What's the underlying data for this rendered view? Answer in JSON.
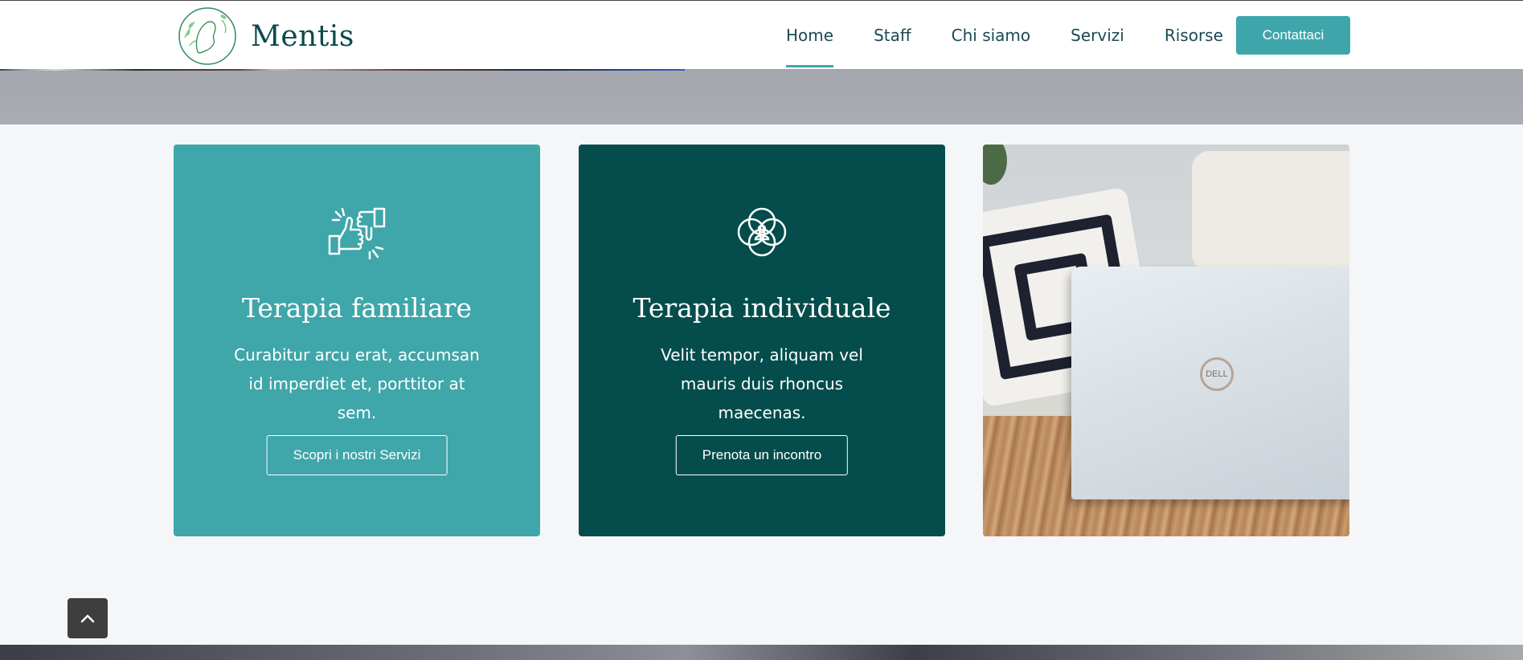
{
  "brand": {
    "name": "Mentis",
    "accent": "#3ea6aa",
    "dark": "#044d4c"
  },
  "nav": {
    "items": [
      {
        "label": "Home",
        "active": true
      },
      {
        "label": "Staff"
      },
      {
        "label": "Chi siamo"
      },
      {
        "label": "Servizi"
      },
      {
        "label": "Risorse"
      }
    ],
    "cta": "Contattaci"
  },
  "cards": [
    {
      "icon": "handshake-icon",
      "title": "Terapia familiare",
      "text": "Curabitur arcu erat, accumsan id imperdiet et, porttitor at sem.",
      "button": "Scopri i nostri Servizi",
      "color": "#3fa6a9"
    },
    {
      "icon": "flower-person-icon",
      "title": "Terapia individuale",
      "text": "Velit tempor, aliquam vel mauris duis rhoncus maecenas.",
      "button": "Prenota un incontro",
      "color": "#044d4c"
    },
    {
      "image": "laptop-photo",
      "logo_text": "DELL"
    }
  ]
}
